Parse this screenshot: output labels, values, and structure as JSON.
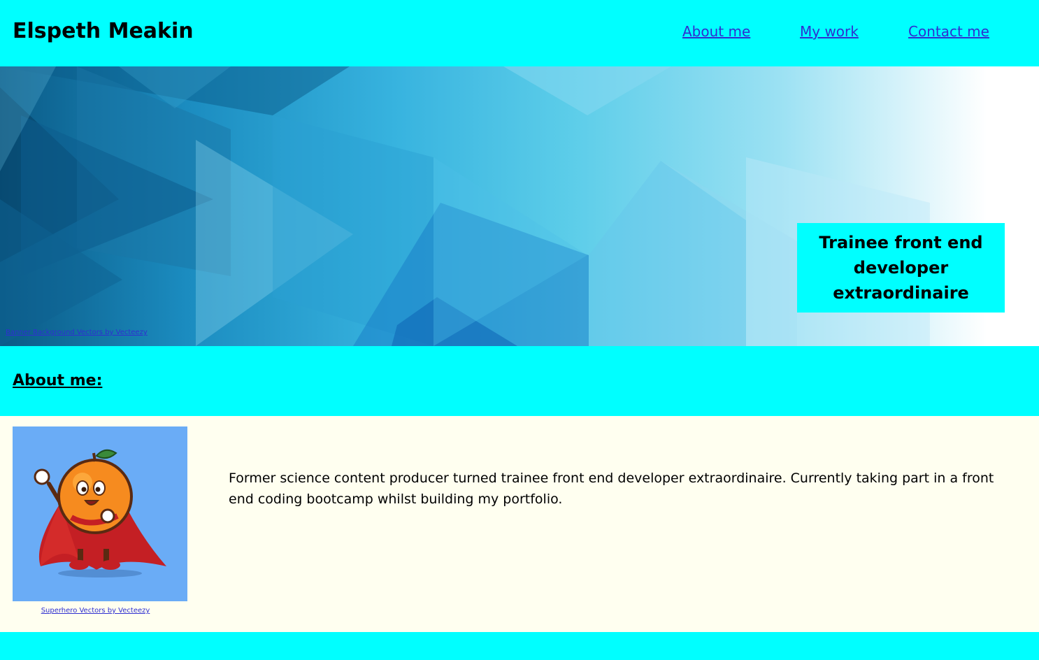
{
  "header": {
    "site_title": "Elspeth Meakin",
    "nav": {
      "about": "About me",
      "work": "My work",
      "contact": "Contact me"
    }
  },
  "hero": {
    "tagline": "Trainee front end developer extraordinaire",
    "credit": "Banner Background Vectors by Vecteezy"
  },
  "about": {
    "heading": "About me:",
    "image_credit": "Superhero Vectors by Vecteezy",
    "bio": "Former science content producer turned trainee front end developer extraordinaire. Currently taking part in a front end coding bootcamp whilst building my portfolio."
  },
  "colors": {
    "band": "#00FFFF",
    "content_bg": "#FFFFF0",
    "link": "#2f2fd0"
  }
}
